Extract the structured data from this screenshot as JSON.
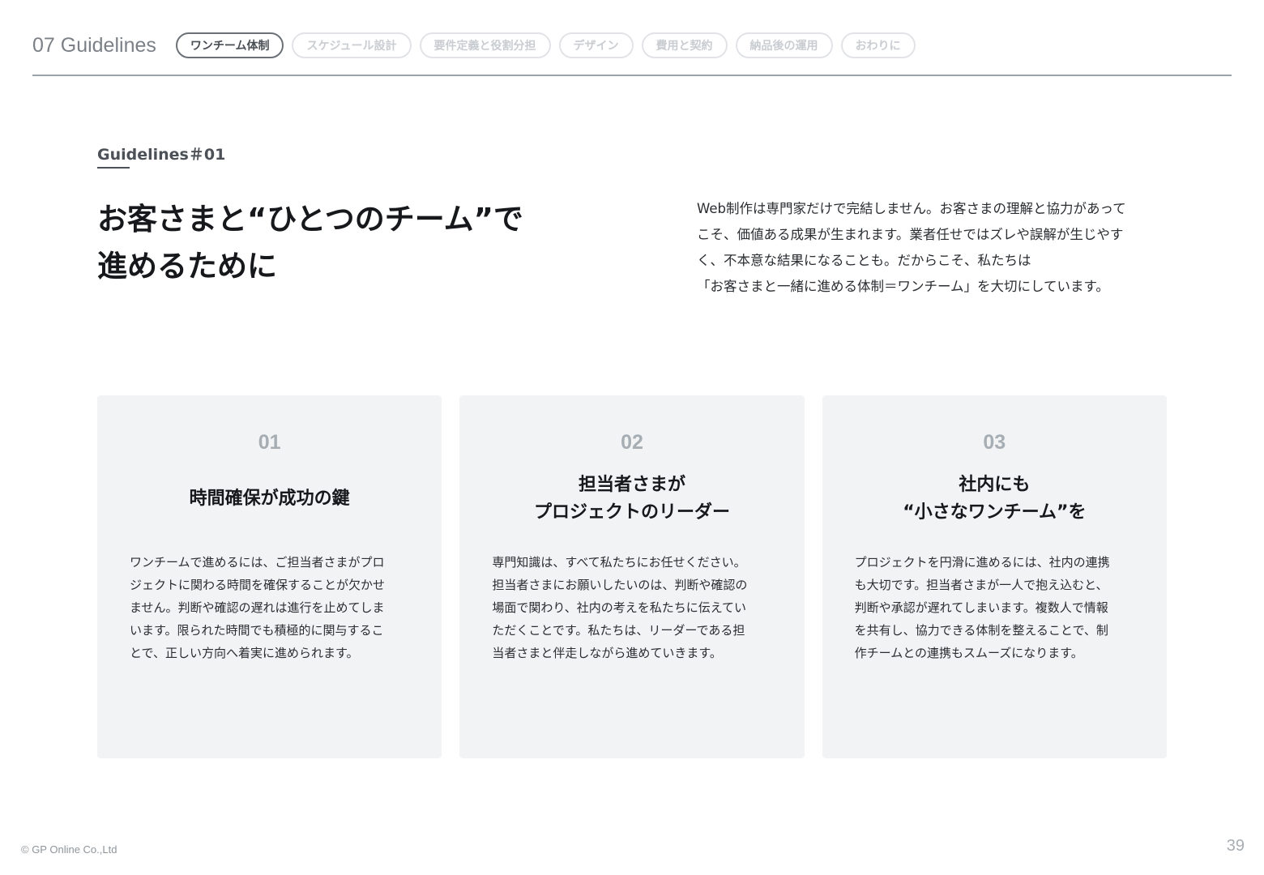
{
  "header": {
    "section_title": "07 Guidelines",
    "tabs": [
      {
        "label": "ワンチーム体制",
        "active": true
      },
      {
        "label": "スケジュール設計",
        "active": false
      },
      {
        "label": "要件定義と役割分担",
        "active": false
      },
      {
        "label": "デザイン",
        "active": false
      },
      {
        "label": "費用と契約",
        "active": false
      },
      {
        "label": "納品後の運用",
        "active": false
      },
      {
        "label": "おわりに",
        "active": false
      }
    ]
  },
  "main": {
    "eyebrow": "Guidelines＃01",
    "headline": [
      "お客さまと“ひとつのチーム”で",
      "進めるために"
    ],
    "intro": [
      "Web制作は専門家だけで完結しません。お客さまの理解と協力があって",
      "こそ、価値ある成果が生まれます。業者任せではズレや誤解が生じやす",
      "く、不本意な結果になることも。だからこそ、私たちは",
      "「お客さまと一緒に進める体制＝ワンチーム」を大切にしています。"
    ]
  },
  "cards": [
    {
      "number": "01",
      "title": [
        "時間確保が成功の鍵"
      ],
      "body": [
        "ワンチームで進めるには、ご担当者さまがプロ",
        "ジェクトに関わる時間を確保することが欠かせ",
        "ません。判断や確認の遅れは進行を止めてしま",
        "います。限られた時間でも積極的に関与するこ",
        "とで、正しい方向へ着実に進められます。"
      ]
    },
    {
      "number": "02",
      "title": [
        "担当者さまが",
        "プロジェクトのリーダー"
      ],
      "body": [
        "専門知識は、すべて私たちにお任せください。",
        "担当者さまにお願いしたいのは、判断や確認の",
        "場面で関わり、社内の考えを私たちに伝えてい",
        "ただくことです。私たちは、リーダーである担",
        "当者さまと伴走しながら進めていきます。"
      ]
    },
    {
      "number": "03",
      "title": [
        "社内にも",
        "“小さなワンチーム”を"
      ],
      "body": [
        "プロジェクトを円滑に進めるには、社内の連携",
        "も大切です。担当者さまが一人で抱え込むと、",
        "判断や承認が遅れてしまいます。複数人で情報",
        "を共有し、協力できる体制を整えることで、制",
        "作チームとの連携もスムーズになります。"
      ]
    }
  ],
  "footer": {
    "copyright": "© GP Online Co.,Ltd",
    "page_number": "39"
  }
}
